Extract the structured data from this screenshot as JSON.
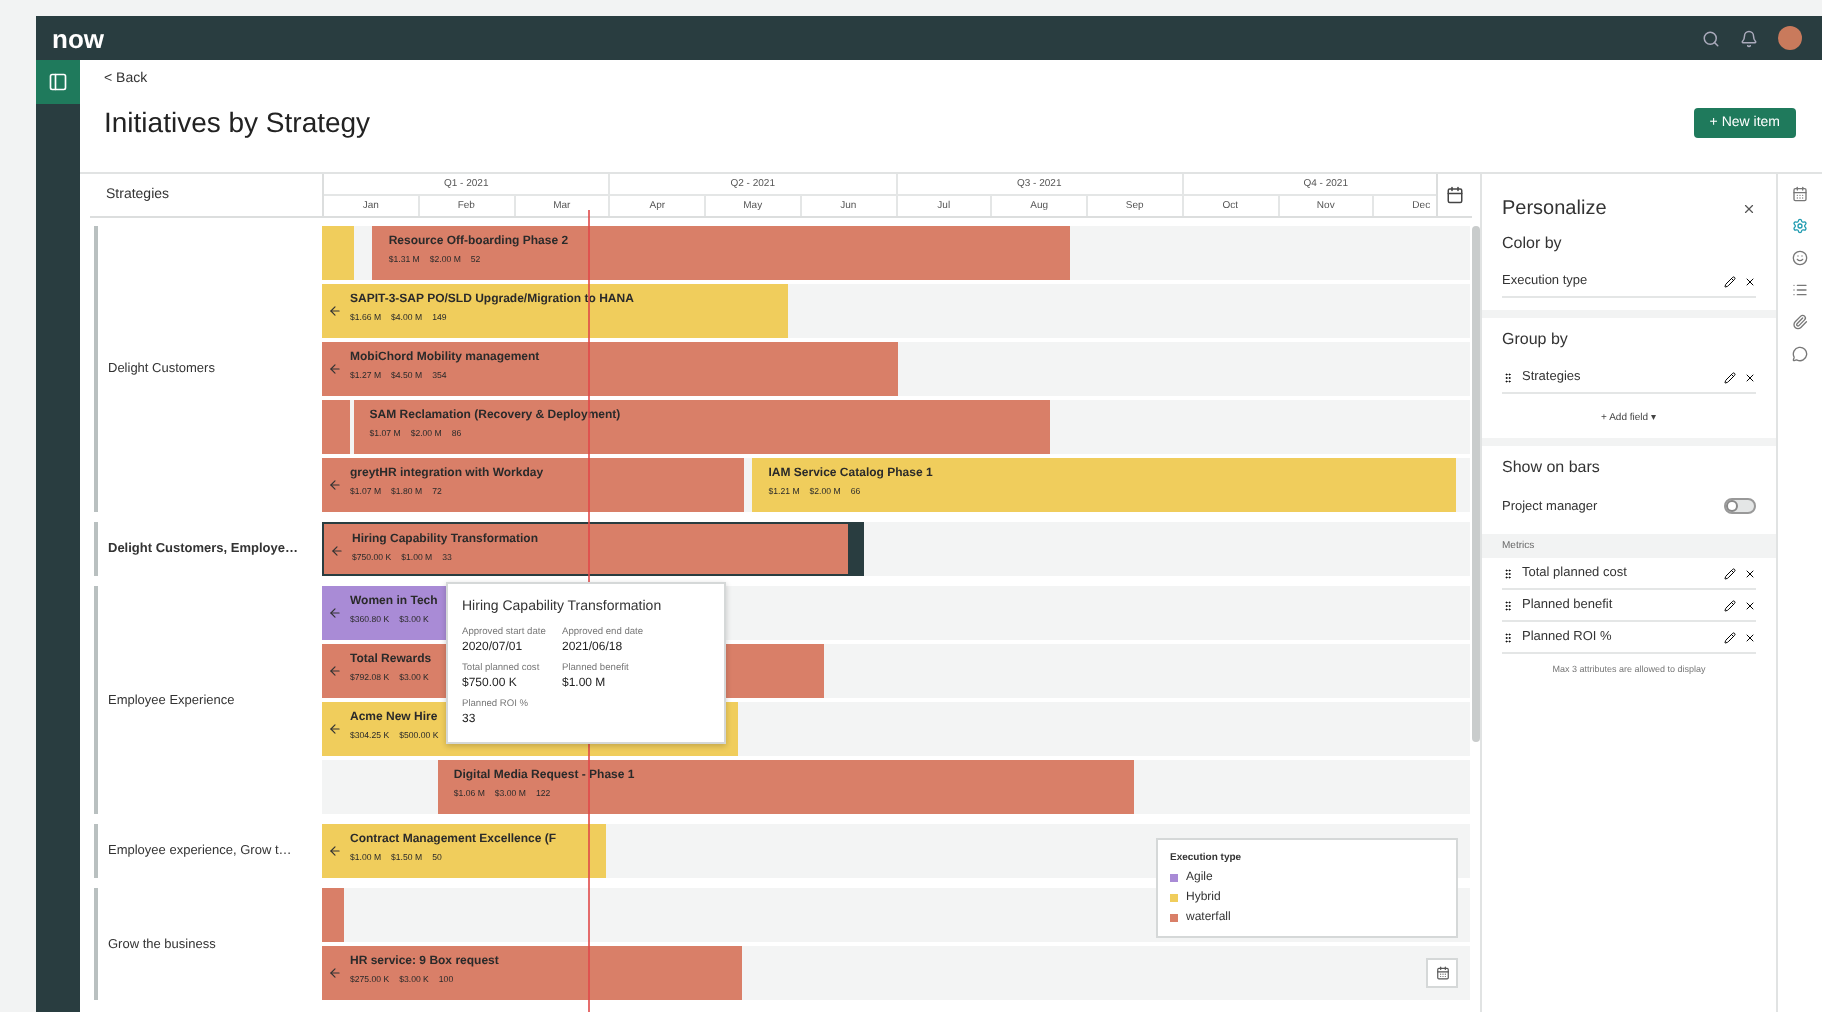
{
  "top_bar": {
    "logo": "now"
  },
  "back_link": "< Back",
  "title": "Initiatives by Strategy",
  "new_button": "+ New item",
  "timeline": {
    "strategies_header": "Strategies",
    "quarters": [
      "Q1 - 2021",
      "Q2 - 2021",
      "Q3 - 2021",
      "Q4 - 2021"
    ],
    "months": [
      "Jan",
      "Feb",
      "Mar",
      "Apr",
      "May",
      "Jun",
      "Jul",
      "Aug",
      "Sep",
      "Oct",
      "Nov",
      "Dec"
    ]
  },
  "strategies": [
    {
      "label": "Delight Customers",
      "selected": false,
      "lanes": [
        {
          "bars": [
            {
              "color": "#f0cd5c",
              "continues_before": false,
              "selected": false
            },
            {
              "title": "Resource Off-boarding Phase 2",
              "metrics": [
                "$1.31 M",
                "$2.00 M",
                "52"
              ],
              "color": "#d97f68",
              "continues_before": false,
              "selected": false
            }
          ]
        },
        {
          "bars": [
            {
              "title": "SAPIT-3-SAP PO/SLD Upgrade/Migration to HANA",
              "metrics": [
                "$1.66 M",
                "$4.00 M",
                "149"
              ],
              "color": "#f0cd5c",
              "continues_before": true,
              "selected": false
            }
          ]
        },
        {
          "bars": [
            {
              "title": "MobiChord Mobility management",
              "metrics": [
                "$1.27 M",
                "$4.50 M",
                "354"
              ],
              "color": "#d97f68",
              "continues_before": true,
              "selected": false
            }
          ]
        },
        {
          "bars": [
            {
              "color": "#d97f68",
              "continues_before": false,
              "selected": false
            },
            {
              "title": "SAM Reclamation (Recovery & Deployment)",
              "metrics": [
                "$1.07 M",
                "$2.00 M",
                "86"
              ],
              "color": "#d97f68",
              "continues_before": false,
              "selected": false
            }
          ]
        },
        {
          "bars": [
            {
              "title": "greytHR integration with Workday",
              "metrics": [
                "$1.07 M",
                "$1.80 M",
                "72"
              ],
              "color": "#d97f68",
              "continues_before": true,
              "selected": false
            },
            {
              "title": "IAM Service Catalog Phase 1",
              "metrics": [
                "$1.21 M",
                "$2.00 M",
                "66"
              ],
              "color": "#f0cd5c",
              "continues_before": false,
              "selected": false
            }
          ]
        }
      ]
    },
    {
      "label": "Delight Customers, Employe…",
      "selected": true,
      "lanes": [
        {
          "bars": [
            {
              "title": "Hiring Capability Transformation",
              "metrics": [
                "$750.00 K",
                "$1.00 M",
                "33"
              ],
              "color": "#d97f68",
              "continues_before": true,
              "selected": true
            }
          ]
        }
      ]
    },
    {
      "label": "Employee Experience",
      "selected": false,
      "lanes": [
        {
          "bars": [
            {
              "title": "Women in Tech",
              "metrics": [
                "$360.80 K",
                "$3.00 K"
              ],
              "color": "#a98bd6",
              "continues_before": true,
              "selected": false
            }
          ]
        },
        {
          "bars": [
            {
              "title": "Total Rewards",
              "metrics": [
                "$792.08 K",
                "$3.00 K"
              ],
              "color": "#d97f68",
              "continues_before": true,
              "selected": false
            }
          ]
        },
        {
          "bars": [
            {
              "title": "Acme New Hire",
              "metrics": [
                "$304.25 K",
                "$500.00 K"
              ],
              "color": "#f0cd5c",
              "continues_before": true,
              "selected": false
            }
          ]
        },
        {
          "bars": [
            {
              "title": "Digital Media Request - Phase 1",
              "metrics": [
                "$1.06 M",
                "$3.00 M",
                "122"
              ],
              "color": "#d97f68",
              "continues_before": false,
              "selected": false
            }
          ]
        }
      ]
    },
    {
      "label": "Employee experience, Grow t…",
      "selected": false,
      "lanes": [
        {
          "bars": [
            {
              "title": "Contract Management Excellence (F",
              "metrics": [
                "$1.00 M",
                "$1.50 M",
                "50"
              ],
              "color": "#f0cd5c",
              "continues_before": true,
              "selected": false
            }
          ]
        }
      ]
    },
    {
      "label": "Grow the business",
      "selected": false,
      "lanes": [
        {
          "bars": [
            {
              "color": "#d97f68",
              "continues_before": false,
              "selected": false
            }
          ]
        },
        {
          "bars": [
            {
              "title": "HR service: 9 Box request",
              "metrics": [
                "$275.00 K",
                "$3.00 K",
                "100"
              ],
              "color": "#d97f68",
              "continues_before": true,
              "selected": false
            }
          ]
        }
      ]
    }
  ],
  "tooltip": {
    "title": "Hiring Capability Transformation",
    "fields": [
      {
        "label": "Approved start date",
        "value": "2020/07/01"
      },
      {
        "label": "Approved end date",
        "value": "2021/06/18"
      },
      {
        "label": "Total planned cost",
        "value": "$750.00 K"
      },
      {
        "label": "Planned benefit",
        "value": "$1.00 M"
      },
      {
        "label": "Planned ROI %",
        "value": "33"
      }
    ]
  },
  "legend": {
    "title": "Execution type",
    "items": [
      {
        "label": "Agile",
        "color": "#a98bd6"
      },
      {
        "label": "Hybrid",
        "color": "#f0cd5c"
      },
      {
        "label": "waterfall",
        "color": "#d97f68"
      }
    ]
  },
  "personalize": {
    "title": "Personalize",
    "color_by": {
      "heading": "Color by",
      "field": "Execution type"
    },
    "group_by": {
      "heading": "Group by",
      "field": "Strategies",
      "add": "+ Add field ▾"
    },
    "show_on_bars": {
      "heading": "Show on bars",
      "toggles": [
        {
          "label": "Project manager",
          "on": false
        }
      ]
    },
    "metrics": {
      "heading": "Metrics",
      "items": [
        "Total planned cost",
        "Planned benefit",
        "Planned ROI %"
      ],
      "note": "Max 3 attributes are allowed to display"
    }
  }
}
